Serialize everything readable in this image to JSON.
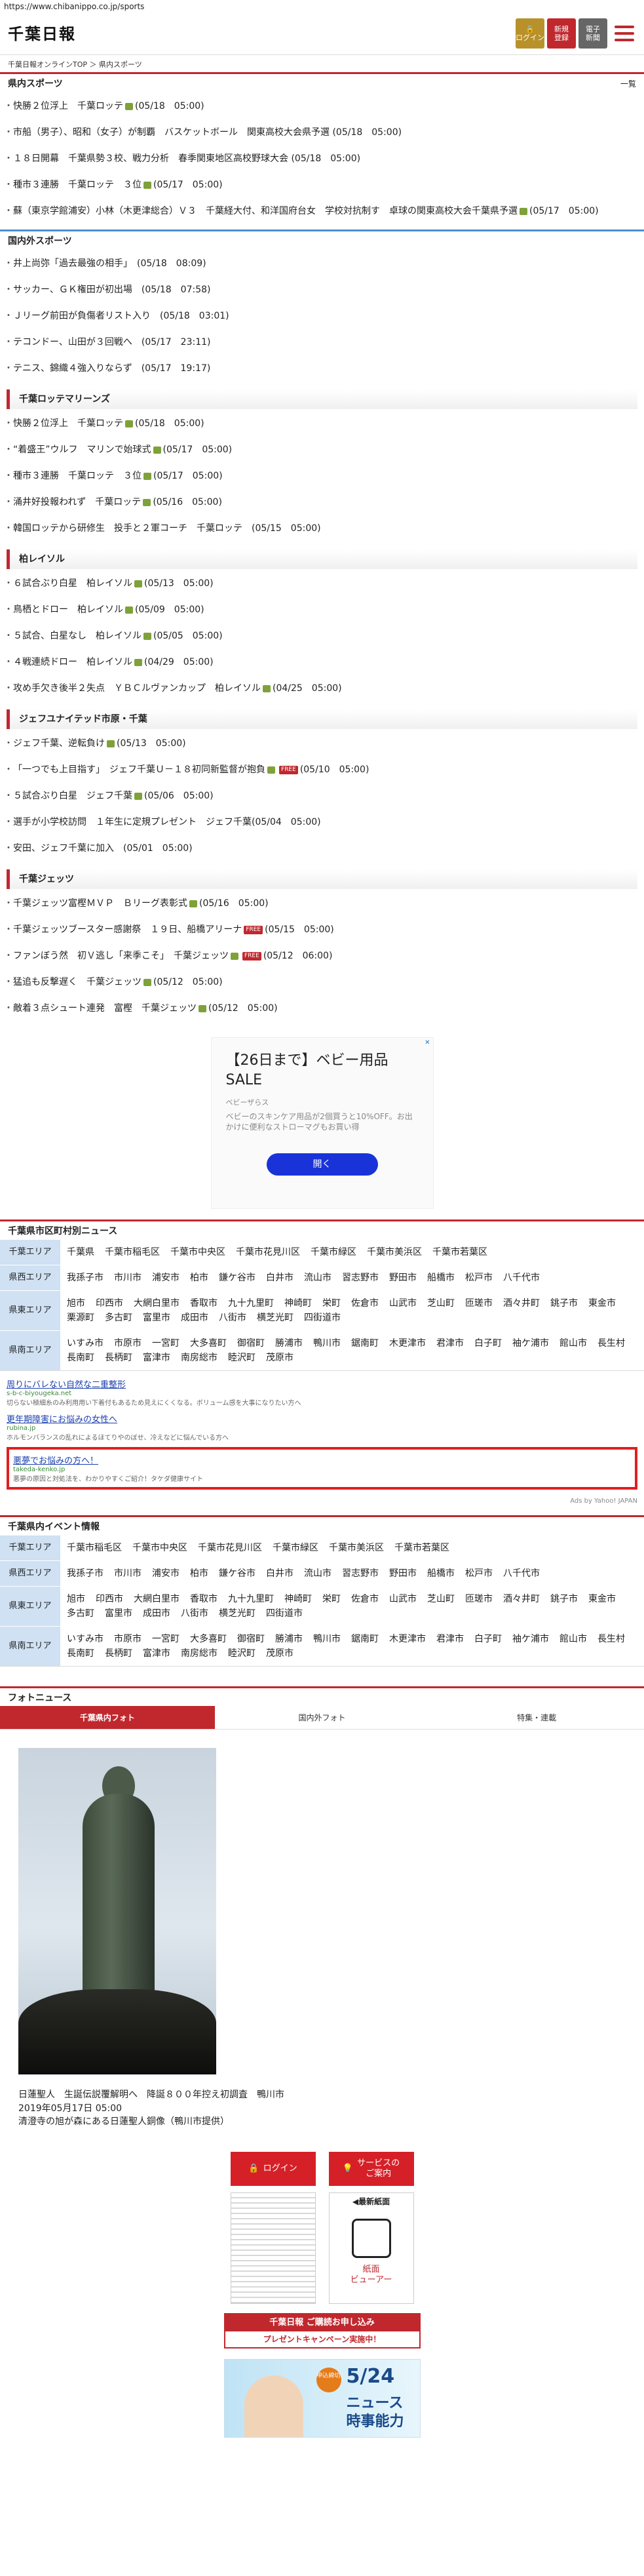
{
  "url": "https://www.chibanippo.co.jp/sports",
  "header": {
    "logo": "千葉日報",
    "login": "ログイン",
    "register_1": "新規",
    "register_2": "登録",
    "paper_1": "電子",
    "paper_2": "新聞"
  },
  "breadcrumb": "千葉日報オンラインTOP ＞ 県内スポーツ",
  "prefecture_sports": {
    "title": "県内スポーツ",
    "more": "一覧",
    "items": [
      "快勝２位浮上　千葉ロッテ",
      "市船（男子）、昭和（女子）が制覇　バスケットボール　関東高校大会県予選 (05/18　05:00)",
      "１８日開幕　千葉県勢３校、戦力分析　春季関東地区高校野球大会 (05/18　05:00)",
      "種市３連勝　千葉ロッテ　３位",
      "蘇（東京学館浦安）小林（木更津総合）Ｖ３　千葉経大付、和洋国府台女　学校対抗制す　卓球の関東高校大会千葉県予選"
    ],
    "times": [
      "(05/18　05:00)",
      "",
      "",
      "(05/17　05:00)",
      "(05/17　05:00)"
    ]
  },
  "other_sports": {
    "title": "国内外スポーツ",
    "items": [
      "井上尚弥「過去最強の相手」　(05/18　08:09)",
      "サッカー、ＧＫ権田が初出場　(05/18　07:58)",
      "Ｊリーグ前田が負傷者リスト入り　(05/18　03:01)",
      "テコンドー、山田が３回戦へ　(05/17　23:11)",
      "テニス、錦織４強入りならず　(05/17　19:17)"
    ]
  },
  "marines": {
    "title": "千葉ロッテマリーンズ",
    "items": [
      "快勝２位浮上　千葉ロッテ",
      "“着盛王”ウルフ　マリンで始球式",
      "種市３連勝　千葉ロッテ　３位",
      "涌井好投報われず　千葉ロッテ",
      "韓国ロッテから研修生　投手と２軍コーチ　千葉ロッテ　(05/15　05:00)"
    ],
    "times": [
      "(05/18　05:00)",
      "(05/17　05:00)",
      "(05/17　05:00)",
      "(05/16　05:00)",
      ""
    ]
  },
  "reysol": {
    "title": "柏レイソル",
    "items": [
      "６試合ぶり白星　柏レイソル",
      "鳥栖とドロー　柏レイソル",
      "５試合、白星なし　柏レイソル",
      "４戦連続ドロー　柏レイソル",
      "攻め手欠き後半２失点　ＹＢＣルヴァンカップ　柏レイソル"
    ],
    "times": [
      "(05/13　05:00)",
      "(05/09　05:00)",
      "(05/05　05:00)",
      "(04/29　05:00)",
      "(04/25　05:00)"
    ]
  },
  "jef": {
    "title": "ジェフユナイテッド市原・千葉",
    "items": [
      "ジェフ千葉、逆転負け",
      "「一つでも上目指す」　ジェフ千葉Ｕ－１８初同新監督が抱負",
      "５試合ぶり白星　ジェフ千葉",
      "選手が小学校訪問　１年生に定規プレゼント　ジェフ千葉",
      "安田、ジェフ千葉に加入　(05/01　05:00)"
    ],
    "times": [
      "(05/13　05:00)",
      "(05/10　05:00)",
      "(05/06　05:00)",
      "(05/04　05:00)",
      ""
    ],
    "free_badge": "FREE"
  },
  "jets": {
    "title": "千葉ジェッツ",
    "items": [
      "千葉ジェッツ富樫ＭＶＰ　Ｂリーグ表彰式",
      "千葉ジェッツブースター感謝祭　１９日、船橋アリーナ",
      "ファンぼう然　初Ｖ逃し「来季こそ」　千葉ジェッツ",
      "猛追も反撃遅く　千葉ジェッツ",
      "敵着３点シュート連発　富樫　千葉ジェッツ"
    ],
    "times": [
      "(05/16　05:00)",
      "(05/15　05:00)",
      "(05/12　06:00)",
      "(05/12　05:00)",
      "(05/12　05:00)"
    ]
  },
  "ad": {
    "close": "✕",
    "title": "【26日まで】ベビー用品SALE",
    "brand": "ベビーザらス",
    "desc": "ベビーのスキンケア用品が2個買うと10%OFF。お出かけに便利なストローマグもお買い得",
    "button": "開く"
  },
  "city_news": {
    "title": "千葉県市区町村別ニュース",
    "rows": [
      {
        "area": "千葉エリア",
        "towns": [
          "千葉県",
          "千葉市稲毛区",
          "千葉市中央区",
          "千葉市花見川区",
          "千葉市緑区",
          "千葉市美浜区",
          "千葉市若葉区"
        ]
      },
      {
        "area": "県西エリア",
        "towns": [
          "我孫子市",
          "市川市",
          "浦安市",
          "柏市",
          "鎌ケ谷市",
          "白井市",
          "流山市",
          "習志野市",
          "野田市",
          "船橋市",
          "松戸市",
          "八千代市"
        ]
      },
      {
        "area": "県東エリア",
        "towns": [
          "旭市",
          "印西市",
          "大網白里市",
          "香取市",
          "九十九里町",
          "神崎町",
          "栄町",
          "佐倉市",
          "山武市",
          "芝山町",
          "匝瑳市",
          "酒々井町",
          "銚子市",
          "東金市",
          "栗源町",
          "多古町",
          "富里市",
          "成田市",
          "八街市",
          "横芝光町",
          "四街道市"
        ]
      },
      {
        "area": "県南エリア",
        "towns": [
          "いすみ市",
          "市原市",
          "一宮町",
          "大多喜町",
          "御宿町",
          "勝浦市",
          "鴨川市",
          "鋸南町",
          "木更津市",
          "君津市",
          "白子町",
          "袖ケ浦市",
          "館山市",
          "長生村",
          "長南町",
          "長柄町",
          "富津市",
          "南房総市",
          "睦沢町",
          "茂原市"
        ]
      }
    ]
  },
  "yahoo_ads": [
    {
      "title": "周りにバレない自然な二重整形",
      "url": "s-b-c-biyougeka.net",
      "desc": "切らない極細糸のみ利用用い下着付もあるため見えにくくなる。ボリューム感を大事になりたい方へ"
    },
    {
      "title": "更年期障害にお悩みの女性へ",
      "url": "rubina.jp",
      "desc": "ホルモンバランスの乱れによるほてりやのぼせ、冷えなどに悩んでいる方へ"
    },
    {
      "title": "悪夢でお悩みの方へ！",
      "url": "takeda-kenko.jp",
      "desc": "悪夢の原因と対処法を、わかりやすくご紹介！タケダ健康サイト"
    }
  ],
  "yahoo_foot": "Ads by Yahoo! JAPAN",
  "event_info": {
    "title": "千葉県内イベント情報",
    "rows": [
      {
        "area": "千葉エリア",
        "towns": [
          "千葉市稲毛区",
          "千葉市中央区",
          "千葉市花見川区",
          "千葉市緑区",
          "千葉市美浜区",
          "千葉市若葉区"
        ]
      },
      {
        "area": "県西エリア",
        "towns": [
          "我孫子市",
          "市川市",
          "浦安市",
          "柏市",
          "鎌ケ谷市",
          "白井市",
          "流山市",
          "習志野市",
          "野田市",
          "船橋市",
          "松戸市",
          "八千代市"
        ]
      },
      {
        "area": "県東エリア",
        "towns": [
          "旭市",
          "印西市",
          "大網白里市",
          "香取市",
          "九十九里町",
          "神崎町",
          "栄町",
          "佐倉市",
          "山武市",
          "芝山町",
          "匝瑳市",
          "酒々井町",
          "銚子市",
          "東金市",
          "多古町",
          "富里市",
          "成田市",
          "八街市",
          "横芝光町",
          "四街道市"
        ]
      },
      {
        "area": "県南エリア",
        "towns": [
          "いすみ市",
          "市原市",
          "一宮町",
          "大多喜町",
          "御宿町",
          "勝浦市",
          "鴨川市",
          "鋸南町",
          "木更津市",
          "君津市",
          "白子町",
          "袖ケ浦市",
          "館山市",
          "長生村",
          "長南町",
          "長柄町",
          "富津市",
          "南房総市",
          "睦沢町",
          "茂原市"
        ]
      }
    ]
  },
  "photo_news": {
    "title": "フォトニュース",
    "tabs": [
      "千葉県内フォト",
      "国内外フォト",
      "特集・連載"
    ],
    "caption": "日蓮聖人　生誕伝説覆解明へ　降誕８００年控え初調査　鴨川市",
    "date": "2019年05月17日 05:00",
    "desc": "清澄寺の旭が森にある日蓮聖人銅像（鴨川市提供）"
  },
  "side": {
    "login": "ログイン",
    "service_1": "サービスの",
    "service_2": "ご案内",
    "latest_paper": "◀最新紙面",
    "viewer_1": "紙面",
    "viewer_2": "ビューアー",
    "promo_1": "千葉日報 ご購読お申し込み",
    "promo_2": "プレゼントキャンペーン実施中！",
    "banner_tag": "申込締切",
    "banner_date": "5/24",
    "banner_t1": "ニュース",
    "banner_t2": "時事能力"
  }
}
